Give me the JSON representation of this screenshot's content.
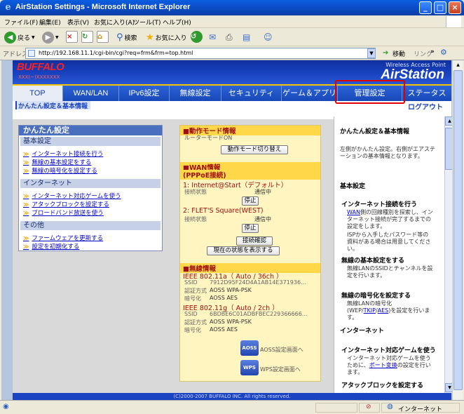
{
  "window": {
    "title": "AirStation Settings - Microsoft Internet Explorer",
    "buttons": {
      "min": "_",
      "max": "□",
      "close": "×"
    }
  },
  "menubar": [
    "ファイル(F)",
    "編集(E)",
    "表示(V)",
    "お気に入り(A)",
    "ツール(T)",
    "ヘルプ(H)"
  ],
  "toolbar": {
    "back": "戻る",
    "search": "検索",
    "favorites": "お気に入り"
  },
  "address": {
    "label": "アドレス(D)",
    "url": "http://192.168.11.1/cgi-bin/cgi?req=frm&frm=top.html",
    "go": "移動",
    "links": "リンク"
  },
  "banner": {
    "brand": "BUFFALO",
    "brand_sub": "XXX(~)XXXXXXX",
    "product_sub": "Wireless Access Point",
    "product": "AirStation"
  },
  "nav": {
    "tabs": [
      "TOP",
      "WAN/LAN",
      "IPv6設定",
      "無線設定",
      "セキュリティ",
      "ゲーム＆アプリ",
      "管理設定",
      "ステータス"
    ],
    "sub_left": "かんたん設定＆基本情報",
    "logout": "ログアウト"
  },
  "left": {
    "title": "かんたん設定",
    "sections": [
      {
        "name": "基本設定",
        "links": [
          "インターネット接続を行う",
          "無線の基本設定をする",
          "無線の暗号化を設定する"
        ]
      },
      {
        "name": "インターネット",
        "links": [
          "インターネット対応ゲームを使う",
          "アタックブロックを設定する",
          "ブロードバンド放送を使う"
        ]
      },
      {
        "name": "その他",
        "links": [
          "ファームウェアを更新する",
          "設定を初期化する"
        ]
      }
    ]
  },
  "center": {
    "mode": {
      "title": "■動作モード情報",
      "value": "ルーターモードON",
      "button": "動作モード切り替え"
    },
    "wan": {
      "title": "■WAN情報",
      "subtitle": "(PPPoE接続)",
      "conn1": {
        "name": "1: Internet@Start（デフォルト）",
        "label": "接続状態",
        "value": "通信中",
        "button": "停止"
      },
      "conn2": {
        "name": "2: FLET'S Square(WEST)",
        "label": "接続状態",
        "value": "通信中",
        "button": "停止"
      },
      "btn_check": "接続確認",
      "btn_status": "現在の状態を表示する"
    },
    "wireless": {
      "title": "■無線情報",
      "a": {
        "name": "IEEE 802.11a（ Auto / 36ch ）",
        "ssid_label": "SSID",
        "ssid": "7912D95F24D4A1AB14E371936...",
        "auth_label": "認証方式",
        "auth": "AOSS WPA-PSK",
        "enc_label": "暗号化",
        "enc": "AOSS AES"
      },
      "g": {
        "name": "IEEE 802.11g（ Auto / 2ch ）",
        "ssid_label": "SSID",
        "ssid": "6BDBE6C01ADBFBEC229366666...",
        "auth_label": "認証方式",
        "auth": "AOSS WPA-PSK",
        "enc_label": "暗号化",
        "enc": "AOSS AES"
      },
      "aoss_link": "AOSS設定画面へ",
      "wps_link": "WPS設定画面へ",
      "aoss_logo": "AOSS",
      "wps_logo": "WPS"
    }
  },
  "right": {
    "title": "かんたん設定＆基本情報",
    "intro": "左側がかんたん設定。右側がエアステーションの基本情報となります。",
    "basic": "基本設定",
    "item1": {
      "title": "インターネット接続を行う",
      "link": "WAN",
      "text1": "側の回線種別を探索し、インターネット接続が完了するまでの設定をします。",
      "text2": "ISPから入手したパスワード等の資料がある場合は用意してください。"
    },
    "item2": {
      "title": "無線の基本設定をする",
      "text": "無線LANのSSIDとチャンネルを設定を行います。"
    },
    "item3": {
      "title": "無線の暗号化を設定する",
      "pre": "無線LANの暗号化(WEP/",
      "tkip": "TKIP",
      "sep": "/",
      "aes": "AES",
      "post": ")を設定を行います。"
    },
    "internet": "インターネット",
    "item4": {
      "title": "インターネット対応ゲームを使う",
      "pre": "インターネット対応ゲームを使うために、",
      "link": "ポート変換",
      "post": "の設定を行います。"
    },
    "item5": {
      "title": "アタックブロックを設定する"
    }
  },
  "footer": "(C)2000-2007 BUFFALO INC. All rights reserved.",
  "status": {
    "zone": "インターネット"
  }
}
